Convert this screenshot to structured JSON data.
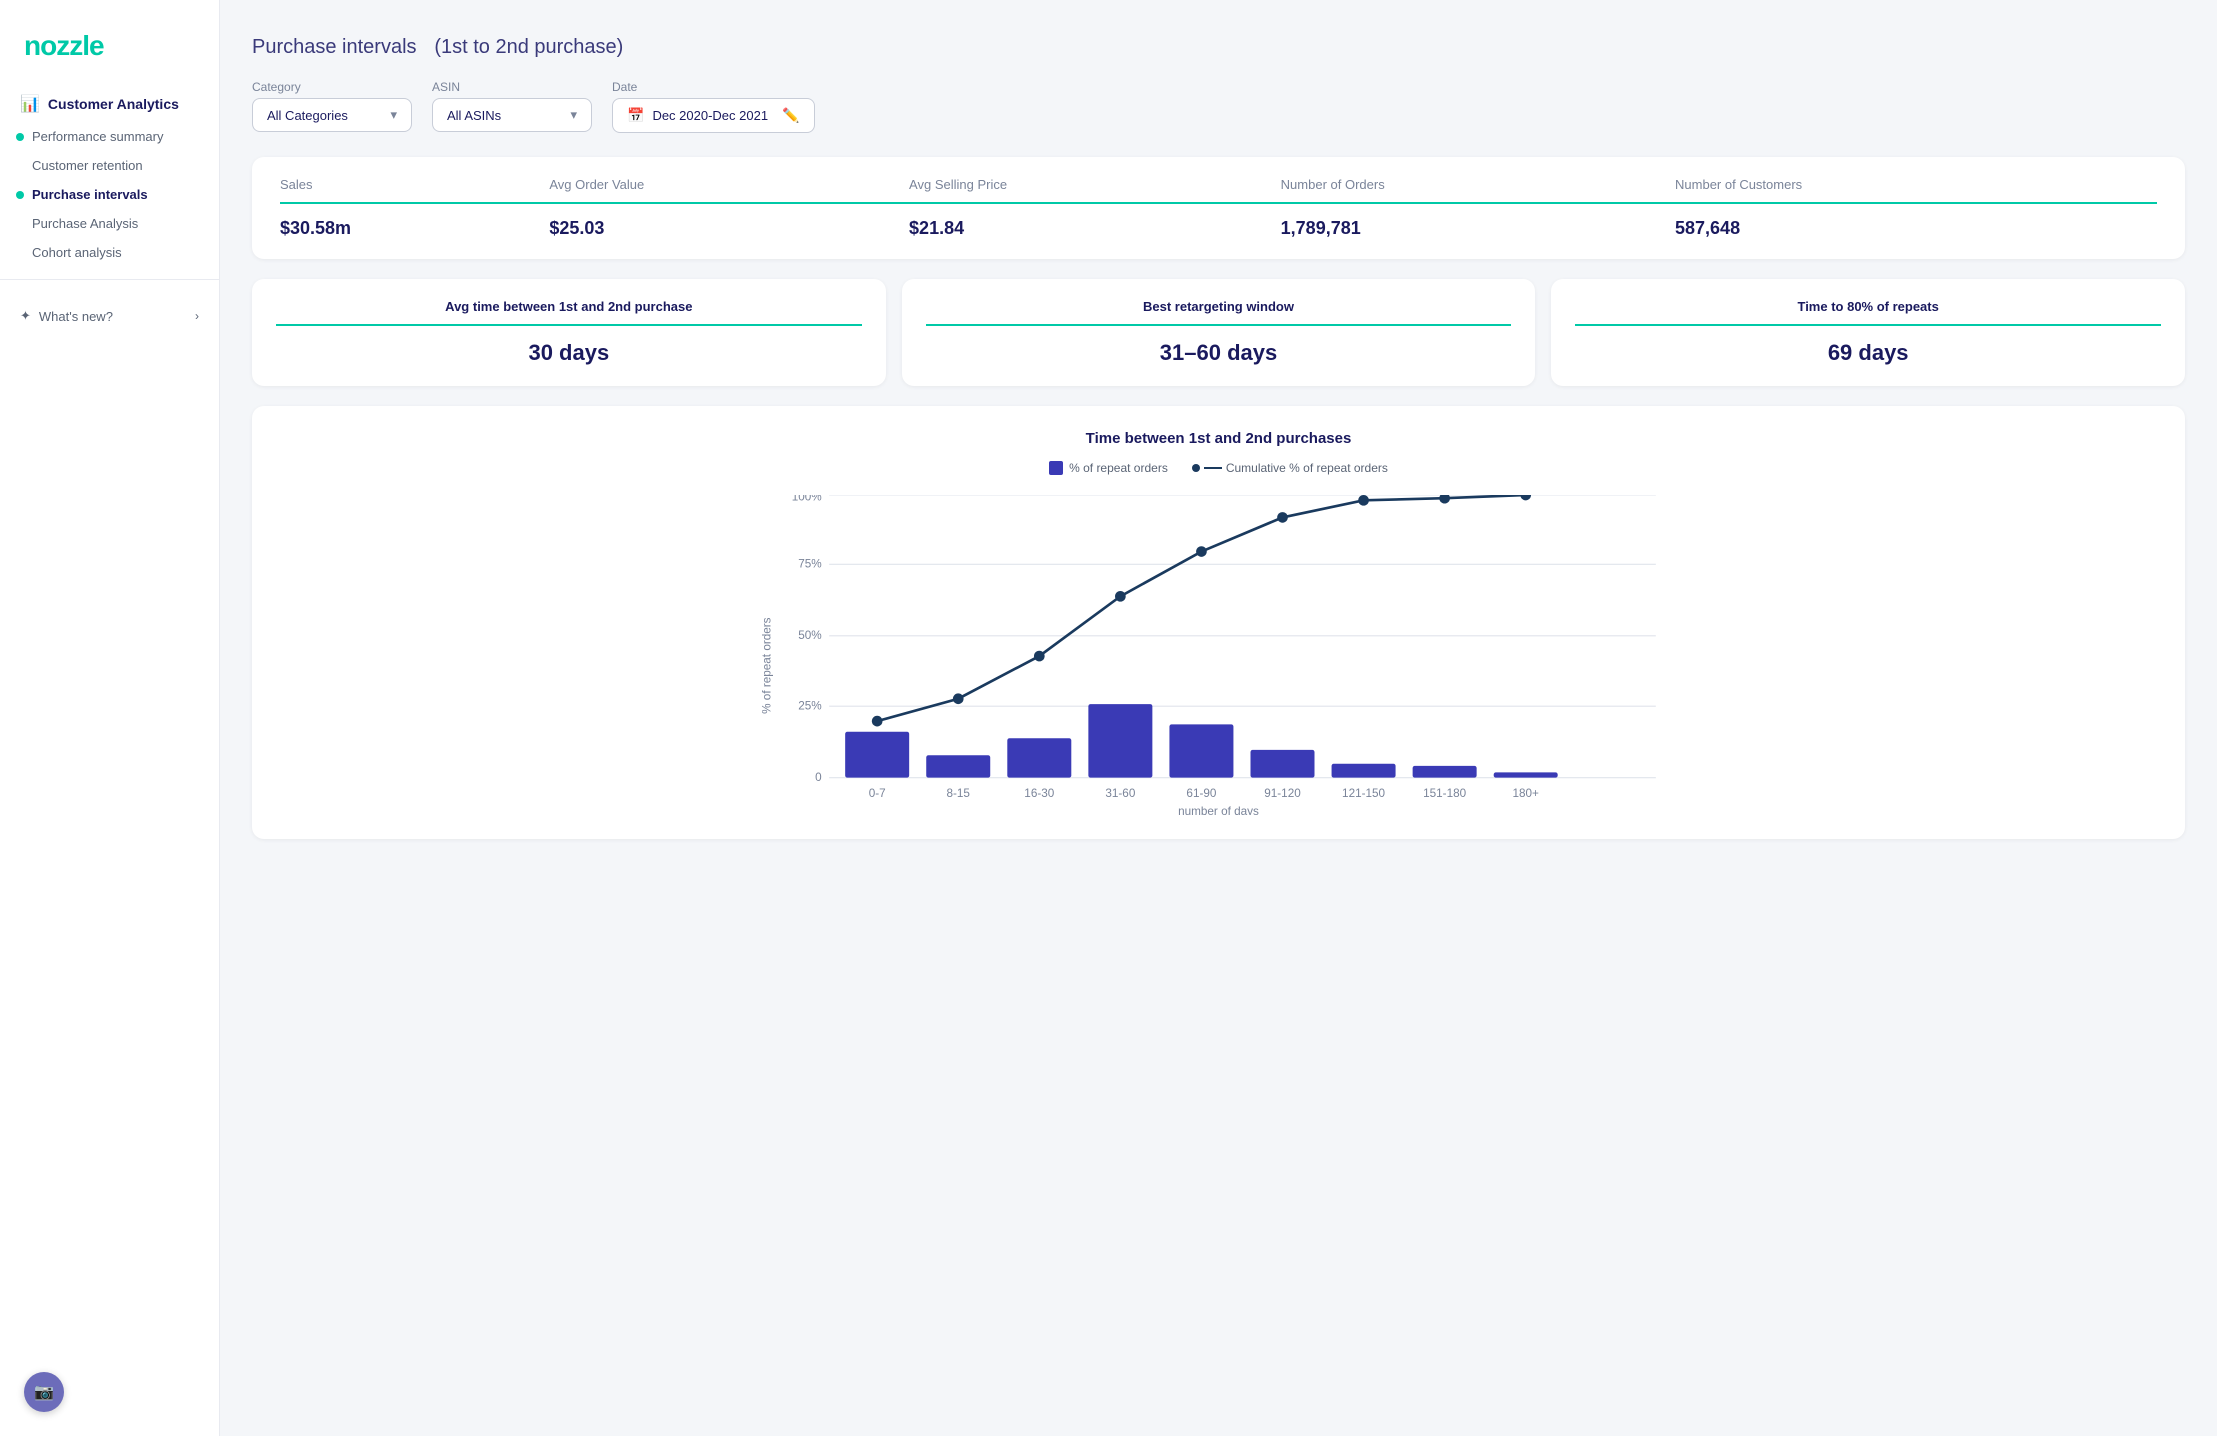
{
  "sidebar": {
    "logo": "nozzle",
    "sections": [
      {
        "label": "Customer Analytics",
        "icon": "📊",
        "items": [
          {
            "label": "Performance summary",
            "active": false,
            "dot": true
          },
          {
            "label": "Customer retention",
            "active": false,
            "dot": false
          },
          {
            "label": "Purchase intervals",
            "active": true,
            "dot": true
          },
          {
            "label": "Purchase Analysis",
            "active": false,
            "dot": false
          },
          {
            "label": "Cohort analysis",
            "active": false,
            "dot": false
          }
        ]
      }
    ],
    "whats_new": "What's new?"
  },
  "header": {
    "title": "Purchase intervals",
    "subtitle": "(1st to 2nd purchase)"
  },
  "filters": {
    "category_label": "Category",
    "category_value": "All Categories",
    "asin_label": "ASIN",
    "asin_value": "All ASINs",
    "date_label": "Date",
    "date_value": "Dec 2020-Dec 2021"
  },
  "stats": {
    "columns": [
      "Sales",
      "Avg Order Value",
      "Avg Selling Price",
      "Number of Orders",
      "Number of Customers"
    ],
    "values": [
      "$30.58m",
      "$25.03",
      "$21.84",
      "1,789,781",
      "587,648"
    ]
  },
  "metrics": [
    {
      "title": "Avg time between 1st and 2nd purchase",
      "value": "30 days"
    },
    {
      "title": "Best retargeting window",
      "value": "31–60 days"
    },
    {
      "title": "Time to 80% of repeats",
      "value": "69 days"
    }
  ],
  "chart": {
    "title": "Time between 1st and 2nd purchases",
    "legend_bar": "% of repeat orders",
    "legend_line": "Cumulative % of repeat orders",
    "y_axis_label": "% of repeat orders",
    "x_axis_label": "number of days",
    "bars": [
      {
        "label": "0-7",
        "value": 16
      },
      {
        "label": "8-15",
        "value": 8
      },
      {
        "label": "16-30",
        "value": 14
      },
      {
        "label": "31-60",
        "value": 26
      },
      {
        "label": "61-90",
        "value": 19
      },
      {
        "label": "91-120",
        "value": 10
      },
      {
        "label": "121-150",
        "value": 5
      },
      {
        "label": "151-180",
        "value": 4
      },
      {
        "label": "180+",
        "value": 2
      }
    ],
    "cumulative": [
      20,
      28,
      43,
      64,
      80,
      92,
      98,
      99,
      100
    ],
    "y_ticks": [
      "0",
      "25%",
      "50%",
      "75%",
      "100%"
    ]
  },
  "video_btn": "🎬"
}
